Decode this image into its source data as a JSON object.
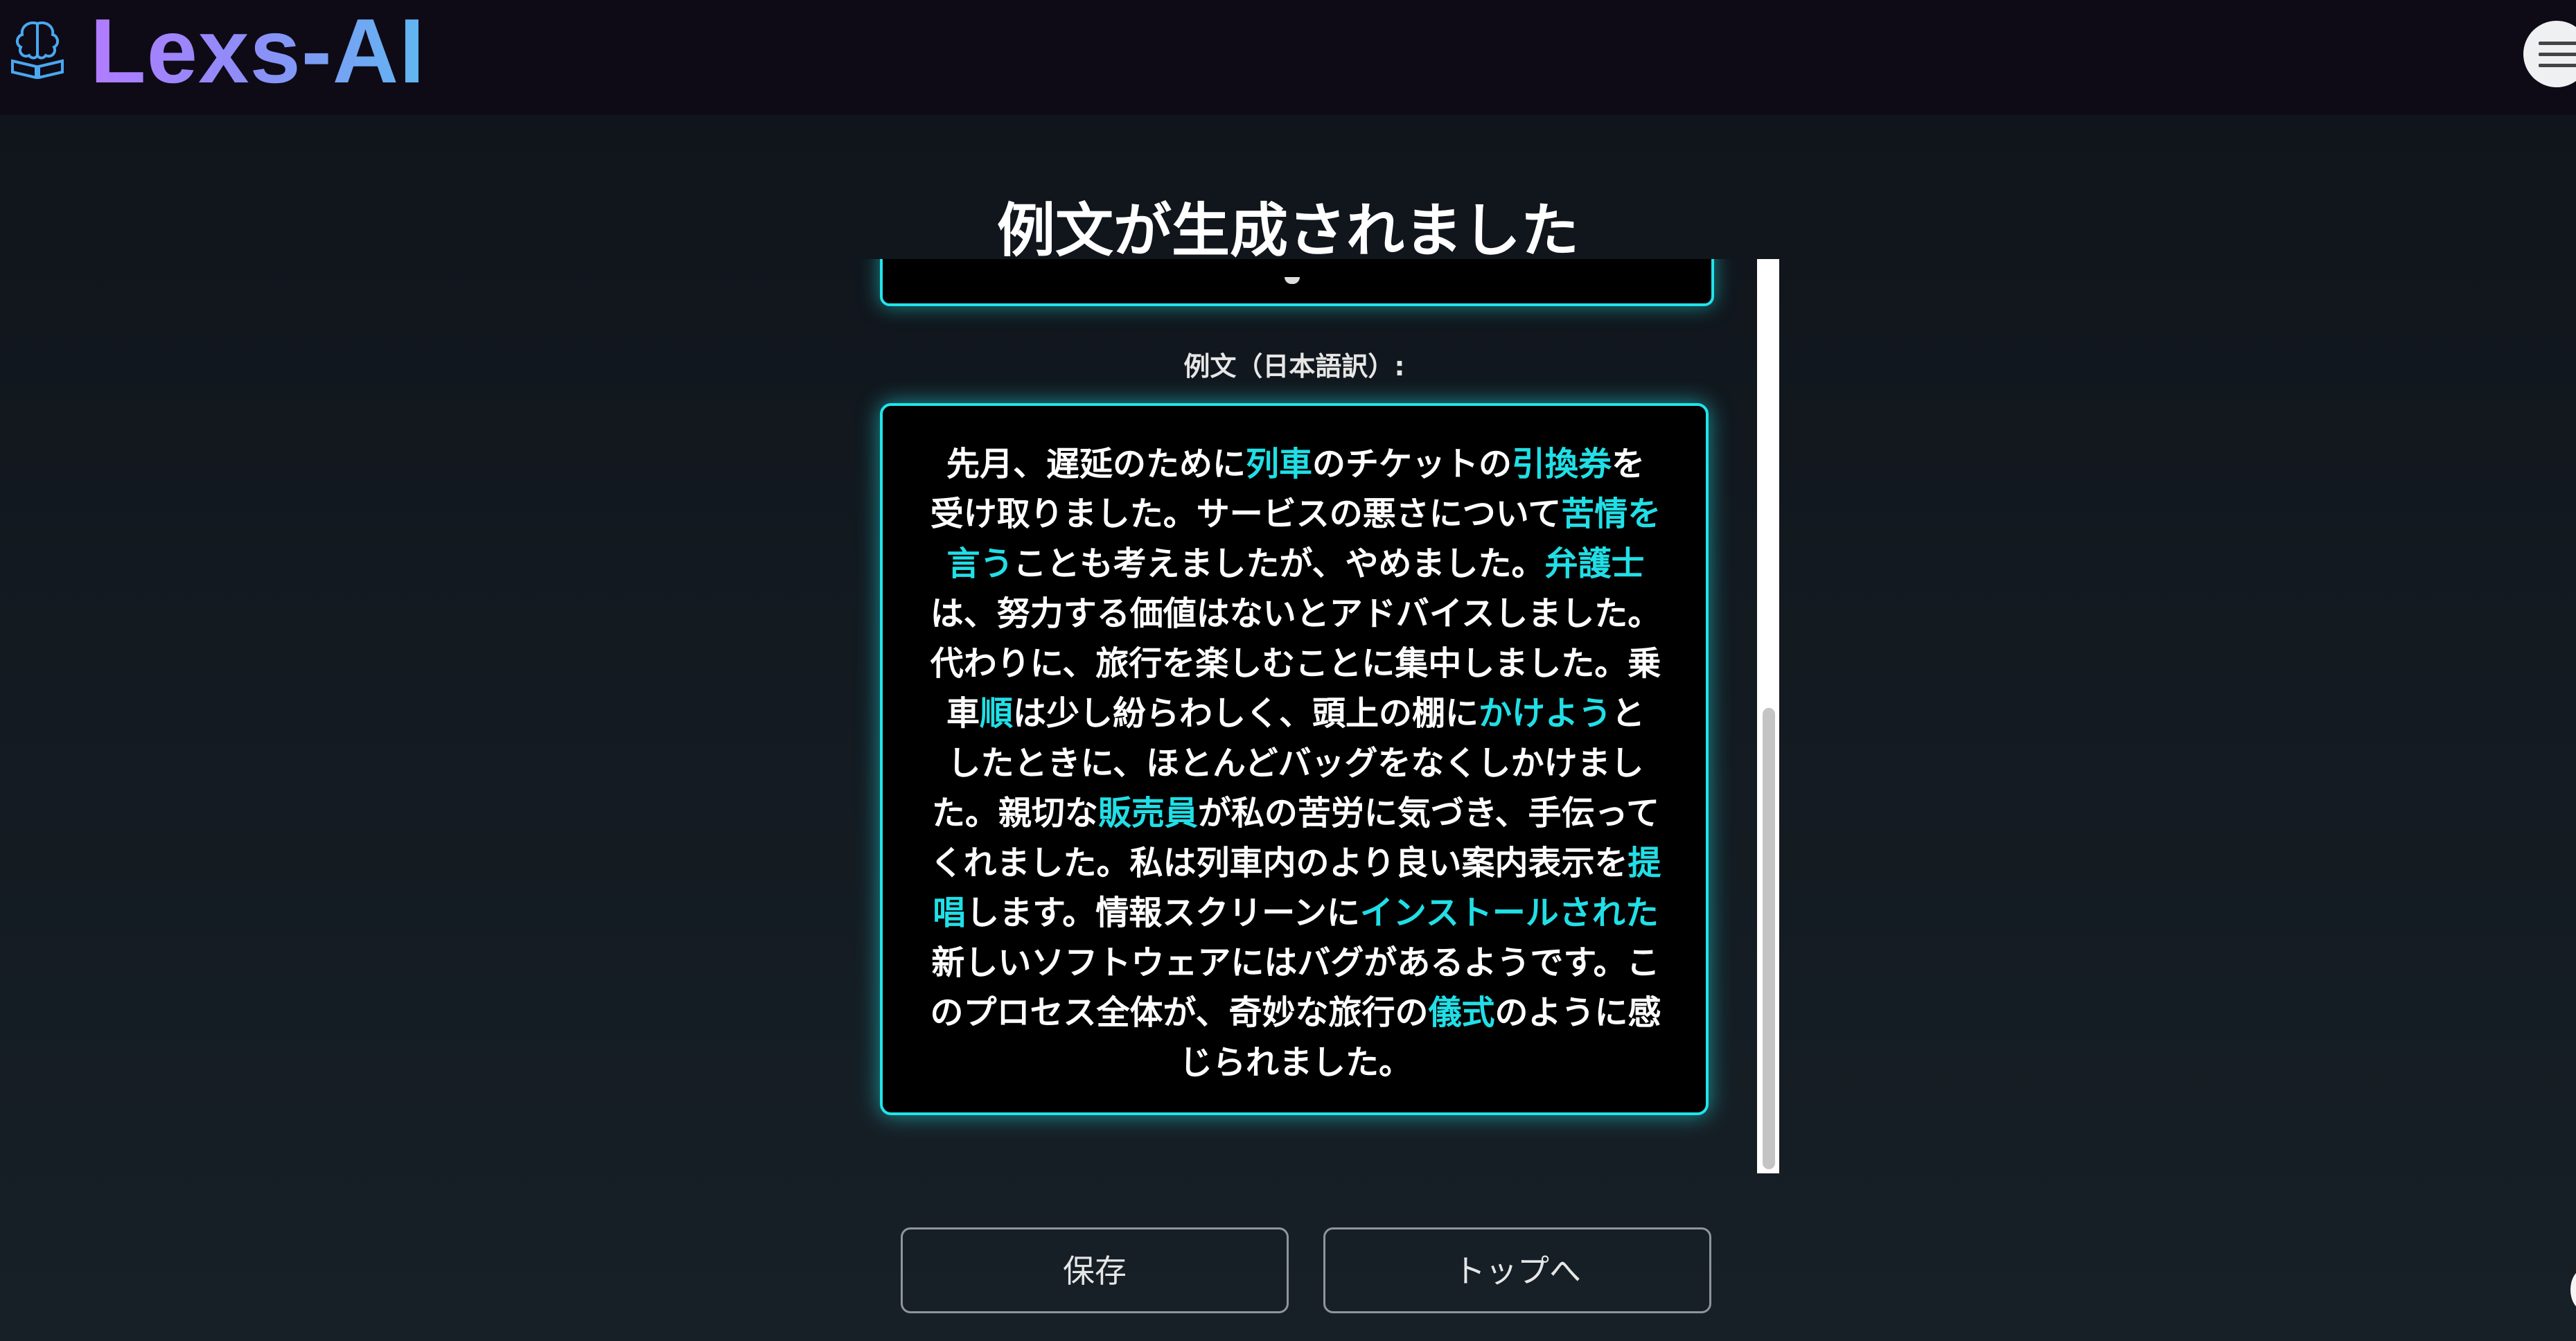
{
  "header": {
    "brand": "Lexs-AI",
    "logo_icon": "brain-book-icon",
    "menu_icon": "hamburger-menu-icon"
  },
  "page": {
    "title": "例文が生成されました"
  },
  "result": {
    "section_label": "例文（日本語訳）:",
    "segments": [
      {
        "text": "先月、遅延のために",
        "highlight": false
      },
      {
        "text": "列車",
        "highlight": true
      },
      {
        "text": "のチケットの",
        "highlight": false
      },
      {
        "text": "引換券",
        "highlight": true
      },
      {
        "text": "を受け取りました。サービスの悪さについて",
        "highlight": false
      },
      {
        "text": "苦情を言う",
        "highlight": true
      },
      {
        "text": "ことも考えましたが、やめました。",
        "highlight": false
      },
      {
        "text": "弁護士",
        "highlight": true
      },
      {
        "text": "は、努力する価値はないとアドバイスしました。代わりに、旅行を楽しむことに集中しました。乗車",
        "highlight": false
      },
      {
        "text": "順",
        "highlight": true
      },
      {
        "text": "は少し紛らわしく、頭上の棚に",
        "highlight": false
      },
      {
        "text": "かけよう",
        "highlight": true
      },
      {
        "text": "としたときに、ほとんどバッグをなくしかけました。親切な",
        "highlight": false
      },
      {
        "text": "販売員",
        "highlight": true
      },
      {
        "text": "が私の苦労に気づき、手伝ってくれました。私は列車内のより良い案内表示を",
        "highlight": false
      },
      {
        "text": "提唱",
        "highlight": true
      },
      {
        "text": "します。情報スクリーンに",
        "highlight": false
      },
      {
        "text": "インストールされた",
        "highlight": true
      },
      {
        "text": "新しいソフトウェアにはバグがあるようです。このプロセス全体が、奇妙な旅行の",
        "highlight": false
      },
      {
        "text": "儀式",
        "highlight": true
      },
      {
        "text": "のように感じられました。",
        "highlight": false
      }
    ]
  },
  "actions": {
    "save_label": "保存",
    "top_label": "トップへ"
  },
  "colors": {
    "accent": "#21e3ea",
    "brand_gradient_start": "#b17cff",
    "brand_gradient_end": "#5fb7f0",
    "card_bg": "#000000",
    "page_bg": "#141a21"
  }
}
